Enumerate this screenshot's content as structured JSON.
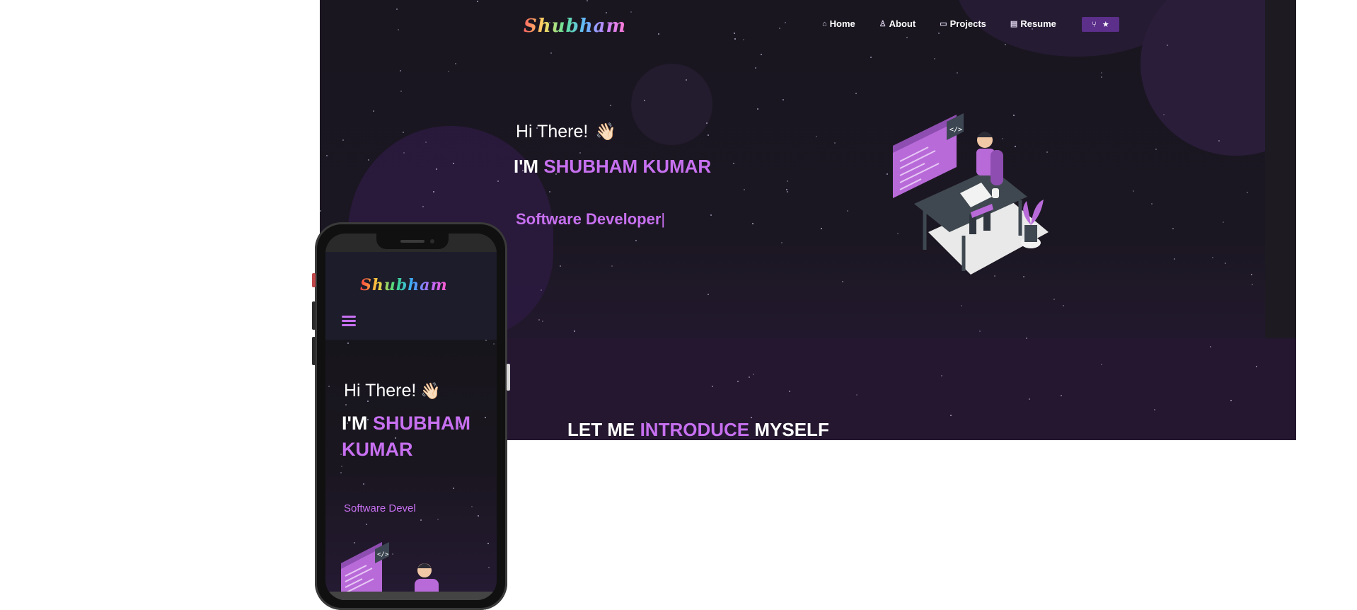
{
  "desktop": {
    "logo": "Shubham",
    "nav": [
      {
        "icon": "home-icon",
        "label": "Home"
      },
      {
        "icon": "user-icon",
        "label": "About"
      },
      {
        "icon": "projects-icon",
        "label": "Projects"
      },
      {
        "icon": "document-icon",
        "label": "Resume"
      }
    ],
    "nav_button": {
      "icons": [
        "fork-icon",
        "star-icon"
      ]
    },
    "greeting": "Hi There!",
    "wave_emoji": "👋🏻",
    "iam_prefix": "I'M",
    "name": "SHUBHAM KUMAR",
    "typed_text": "Software Developer",
    "cursor": "|",
    "intro": {
      "part1": "LET ME",
      "highlight": "INTRODUCE",
      "part2": "MYSELF"
    }
  },
  "phone": {
    "logo": "Shubham",
    "greeting": "Hi There!",
    "wave_emoji": "👋🏻",
    "iam_prefix": "I'M",
    "name": "SHUBHAM KUMAR",
    "typed_text": "Software Devel"
  },
  "colors": {
    "accent": "#c770f0",
    "background": "#1b1722",
    "nav_button": "#5b2f8a"
  }
}
